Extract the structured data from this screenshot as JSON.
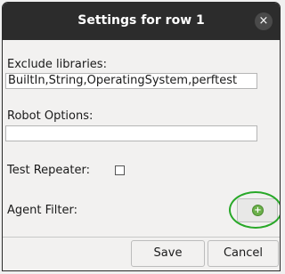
{
  "dialog": {
    "title": "Settings for row 1",
    "close_symbol": "×",
    "exclude_libraries": {
      "label": "Exclude libraries:",
      "value": "BuiltIn,String,OperatingSystem,perftest"
    },
    "robot_options": {
      "label": "Robot Options:",
      "value": ""
    },
    "test_repeater": {
      "label": "Test Repeater:",
      "checked": false
    },
    "agent_filter": {
      "label": "Agent Filter:",
      "icon": "add-circle-icon",
      "icon_glyph": "+"
    },
    "buttons": {
      "save": "Save",
      "cancel": "Cancel"
    }
  },
  "colors": {
    "titlebar": "#2c2c2c",
    "highlight": "#28a828",
    "add_icon": "#6bb04a"
  }
}
